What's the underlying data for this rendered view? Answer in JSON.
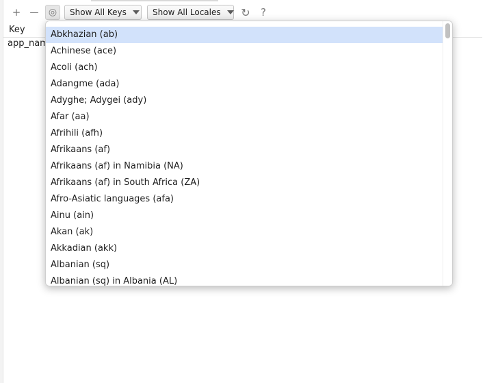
{
  "toolbar": {
    "add_icon": "+",
    "remove_icon": "—",
    "globe_icon": "◎",
    "keys_filter": "Show All Keys",
    "locales_filter": "Show All Locales",
    "reload_icon": "↻",
    "help_icon": "?"
  },
  "table": {
    "columns": [
      "Key"
    ],
    "rows": [
      {
        "key": "app_nam"
      }
    ]
  },
  "popup": {
    "selected_index": 0,
    "items": [
      "Abkhazian (ab)",
      "Achinese (ace)",
      "Acoli (ach)",
      "Adangme (ada)",
      "Adyghe; Adygei (ady)",
      "Afar (aa)",
      "Afrihili (afh)",
      "Afrikaans (af)",
      "Afrikaans (af) in Namibia (NA)",
      "Afrikaans (af) in South Africa (ZA)",
      "Afro-Asiatic languages (afa)",
      "Ainu (ain)",
      "Akan (ak)",
      "Akkadian (akk)",
      "Albanian (sq)",
      "Albanian (sq) in Albania (AL)"
    ]
  },
  "colors": {
    "selection": "#d2e2fb",
    "text": "#1e1e1e",
    "icon": "#7a7a7a"
  }
}
